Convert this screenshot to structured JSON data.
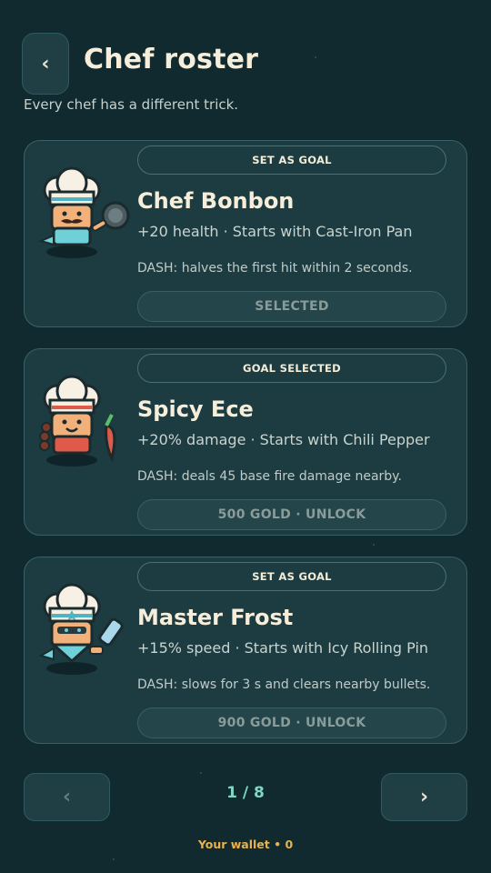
{
  "header": {
    "back_icon": "‹",
    "title": "Chef roster",
    "subtitle": "Every chef has a different trick."
  },
  "chefs": [
    {
      "name": "Chef Bonbon",
      "stats": "+20 health · Starts with Cast-Iron Pan",
      "dash": "DASH: halves the first hit within 2 seconds.",
      "goal_label": "SET AS GOAL",
      "action_label": "SELECTED",
      "icon": "chef-bonbon-portrait-icon"
    },
    {
      "name": "Spicy Ece",
      "stats": "+20% damage · Starts with Chili Pepper",
      "dash": "DASH: deals 45 base fire damage nearby.",
      "goal_label": "GOAL SELECTED",
      "action_label": "500 GOLD · UNLOCK",
      "icon": "spicy-ece-portrait-icon"
    },
    {
      "name": "Master Frost",
      "stats": "+15% speed · Starts with Icy Rolling Pin",
      "dash": "DASH: slows for 3 s and clears nearby bullets.",
      "goal_label": "SET AS GOAL",
      "action_label": "900 GOLD · UNLOCK",
      "icon": "master-frost-portrait-icon"
    }
  ],
  "pagination": {
    "prev_icon": "‹",
    "next_icon": "›",
    "counter": "1 / 8"
  },
  "wallet": "Your wallet • 0",
  "colors": {
    "background": "#112a2f",
    "card": "#1c3c42",
    "accent": "#7fd8c4",
    "gold": "#e9b24e"
  }
}
